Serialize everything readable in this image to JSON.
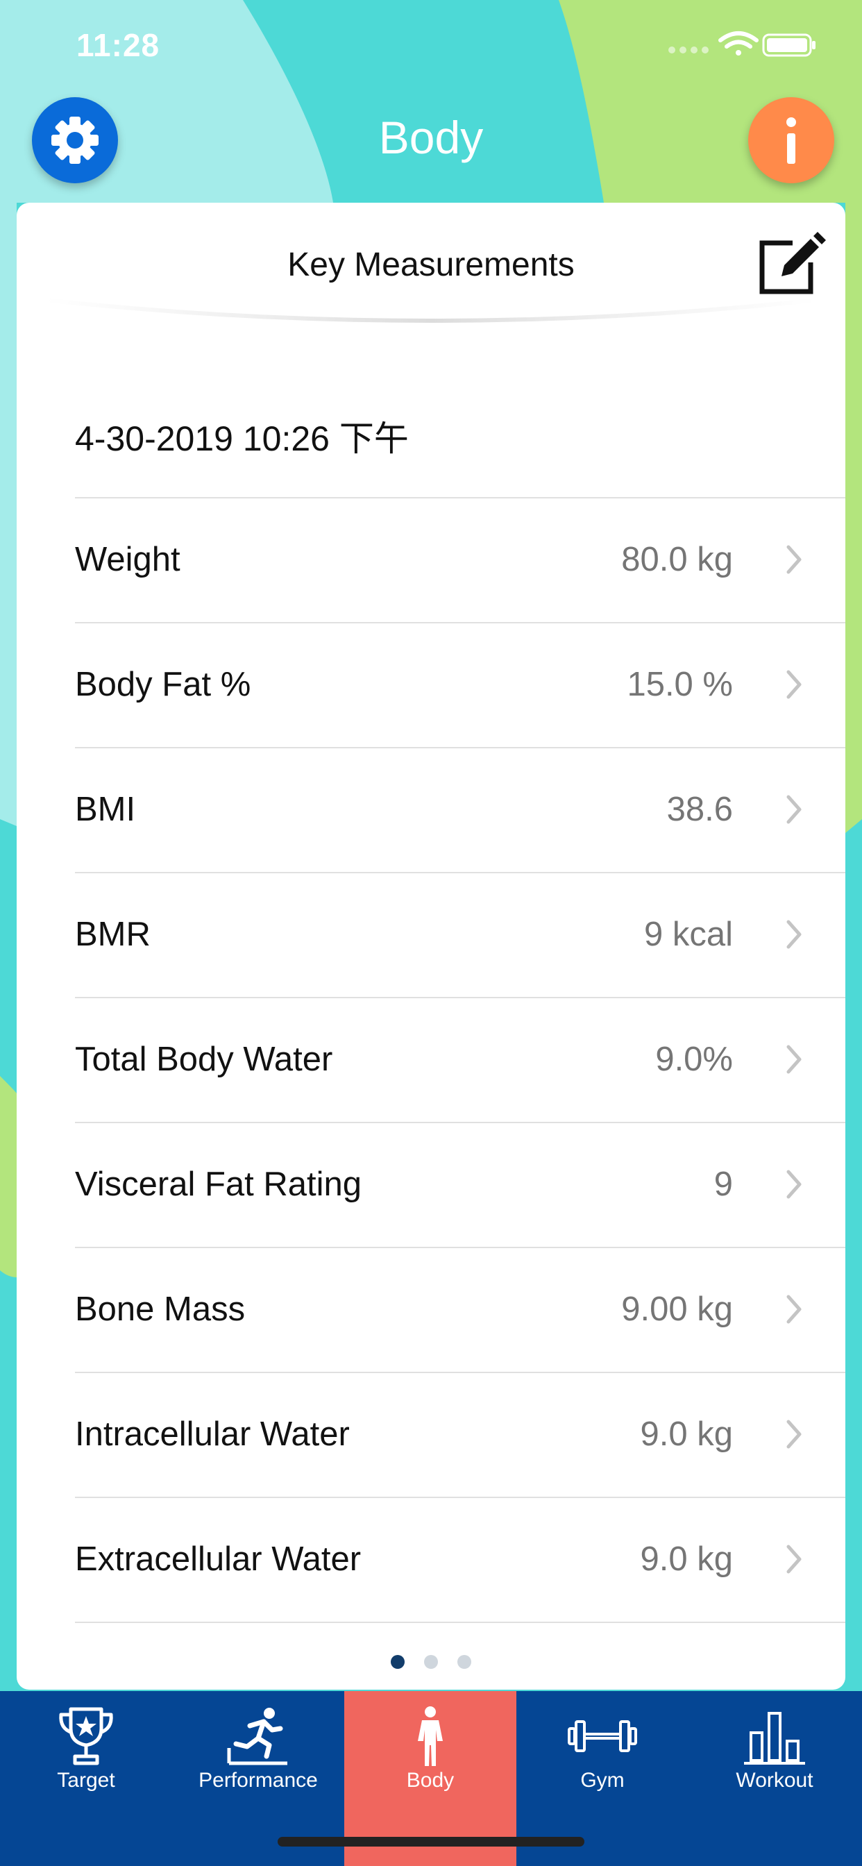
{
  "status": {
    "time": "11:28"
  },
  "header": {
    "title": "Body"
  },
  "card": {
    "title": "Key Measurements",
    "date": "4-30-2019 10:26 下午",
    "rows": [
      {
        "label": "Weight",
        "value": "80.0 kg"
      },
      {
        "label": "Body Fat %",
        "value": "15.0 %"
      },
      {
        "label": "BMI",
        "value": "38.6"
      },
      {
        "label": "BMR",
        "value": "9 kcal"
      },
      {
        "label": "Total Body Water",
        "value": "9.0%"
      },
      {
        "label": "Visceral Fat Rating",
        "value": "9"
      },
      {
        "label": "Bone Mass",
        "value": "9.00 kg"
      },
      {
        "label": "Intracellular Water",
        "value": "9.0 kg"
      },
      {
        "label": "Extracellular Water",
        "value": "9.0 kg"
      }
    ],
    "pager": {
      "pages": 3,
      "current": 1
    }
  },
  "tabs": [
    {
      "label": "Target",
      "icon": "trophy-icon"
    },
    {
      "label": "Performance",
      "icon": "runner-icon"
    },
    {
      "label": "Body",
      "icon": "person-icon",
      "active": true
    },
    {
      "label": "Gym",
      "icon": "dumbbell-icon"
    },
    {
      "label": "Workout",
      "icon": "bar-chart-icon"
    }
  ],
  "colors": {
    "settings_button": "#0a6bd9",
    "info_button": "#ff8a4a",
    "tabbar": "#054694",
    "tab_active": "#f0665e",
    "bg_teal": "#4dd9d6",
    "bg_light_teal": "#a4ecea",
    "bg_green": "#b3e57d"
  }
}
